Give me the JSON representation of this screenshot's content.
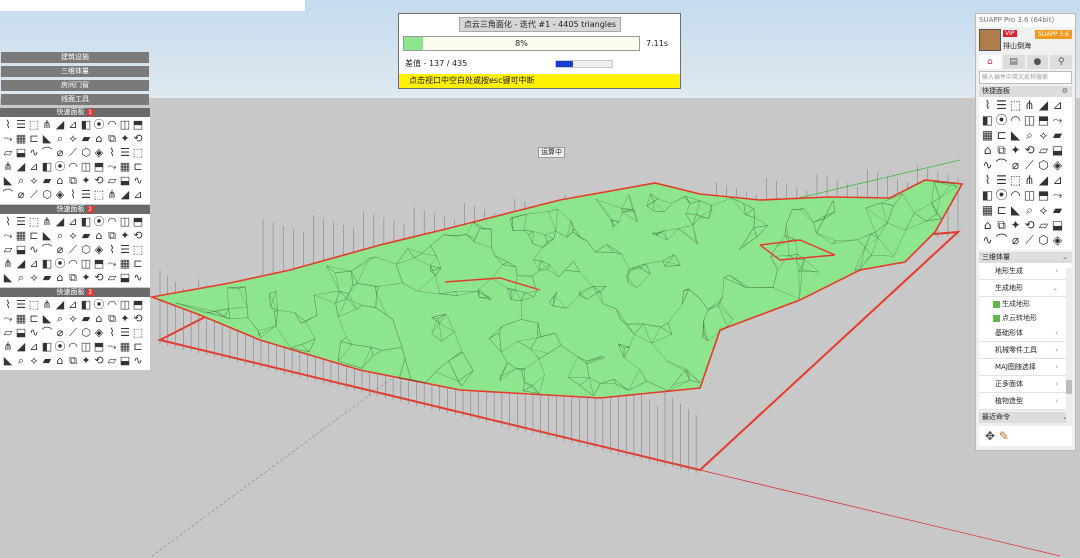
{
  "progress_dialog": {
    "title": "点云三角面化 - 迭代 #1 - 4405 triangles",
    "percent_label": "8%",
    "percent": 0.08,
    "elapsed": "7.11s",
    "error_label": "差值 - 137 / 435",
    "error_progress": 0.31,
    "hint": "点击视口中空白处或按esc键可中断"
  },
  "viewport": {
    "label": "运算中",
    "mesh_color": "#8de68d",
    "edge_color": "#e63a2a",
    "sky_color": "#cfe0ee",
    "ground_color": "#c7c7c7"
  },
  "left_panel": {
    "buttons": [
      "建筑设施",
      "三维体量",
      "房间门窗",
      "线面工具"
    ],
    "palettes": [
      {
        "title": "快速面板",
        "num": "1"
      },
      {
        "title": "快速面板",
        "num": "2"
      },
      {
        "title": "快速面板",
        "num": "3"
      }
    ]
  },
  "suapp": {
    "title": "SUAPP Pro 3.6 (64bit)",
    "vip": "VIP",
    "username": "排山倒海",
    "upgrade": "SUAPP 3.6",
    "search_placeholder": "输入插件中英文名称搜索",
    "quick_panel_title": "快捷面板",
    "sections": {
      "terrain": "三维体量",
      "recent": "最近命令"
    },
    "menu": {
      "items": [
        "地形生成",
        "生成地形",
        "基础形体",
        "机械零件工具",
        "MAJ图随选择",
        "正多面体",
        "植物造型"
      ],
      "subitems": [
        "生成地形",
        "点云转地形"
      ]
    }
  }
}
